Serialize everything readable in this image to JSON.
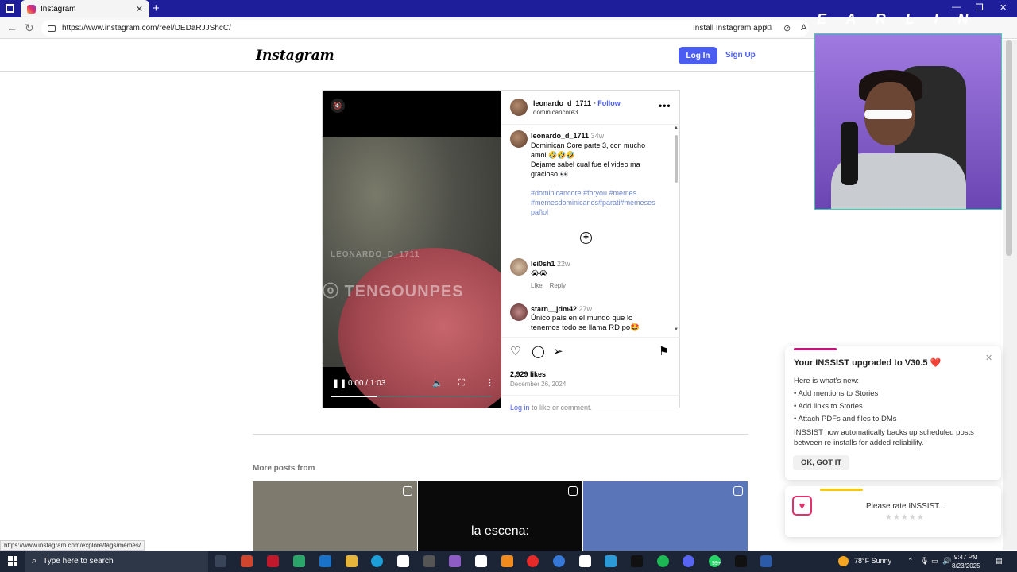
{
  "browser": {
    "tab_title": "Instagram",
    "url": "https://www.instagram.com/reel/DEDaRJJShcC/",
    "install_label": "Install Instagram app"
  },
  "header": {
    "logo": "Instagram",
    "login": "Log In",
    "signup": "Sign Up"
  },
  "post": {
    "author": "leonardo_d_1711",
    "follow": "Follow",
    "author_sub": "dominicancore3",
    "more": "•••",
    "caption_user": "leonardo_d_1711",
    "caption_age": "34w",
    "caption_lines": [
      "Dominican Core parte 3, con mucho",
      "amol.🤣🤣🤣",
      "Dejame sabel cual fue el video ma",
      "gracioso.👀"
    ],
    "tags_lines": [
      "#dominicancore #foryou #memes",
      "#memesdominicanos#parati#memeses",
      "pañol"
    ],
    "comments": [
      {
        "user": "lei0sh1",
        "age": "22w",
        "text": "😭😭",
        "like": "Like",
        "reply": "Reply"
      },
      {
        "user": "starn__jdm42",
        "age": "27w",
        "text": "Único país en el mundo que lo",
        "text2": "tenemos todo se llama RD po🤩"
      }
    ],
    "likes": "2,929 likes",
    "date": "December 26, 2024",
    "login_link": "Log in",
    "login_rest": " to like or comment.",
    "video": {
      "watermark1": "LEONARDO_D_1711",
      "watermark2": "TENGOUNPES",
      "time": "0:00 / 1:03",
      "progress": 0.28
    }
  },
  "more_posts": {
    "label": "More posts from",
    "thumbs": [
      {
        "text": "",
        "bg": "#7e7a6e"
      },
      {
        "text": "la escena:",
        "bg": "#0a0a0a"
      },
      {
        "text": "",
        "bg": "#5b76b8"
      }
    ]
  },
  "overlay": {
    "stream_title": "E A R L I N",
    "inssist_title": "Your INSSIST upgraded to V30.5 ❤️",
    "inssist_intro": "Here is what's new:",
    "inssist_items": [
      "• Add mentions to Stories",
      "• Add links to Stories",
      "• Attach PDFs and files to DMs"
    ],
    "inssist_note": "INSSIST now automatically backs up scheduled posts between re-installs for added reliability.",
    "inssist_ok": "OK, GOT IT",
    "rate_text": "Please rate INSSIST...",
    "rate_stars": "★★★★★"
  },
  "status_url": "https://www.instagram.com/explore/tags/memes/",
  "taskbar": {
    "search_placeholder": "Type here to search",
    "weather": "78°F  Sunny",
    "time": "9:47 PM",
    "date": "8/23/2025",
    "badge": "99+"
  }
}
